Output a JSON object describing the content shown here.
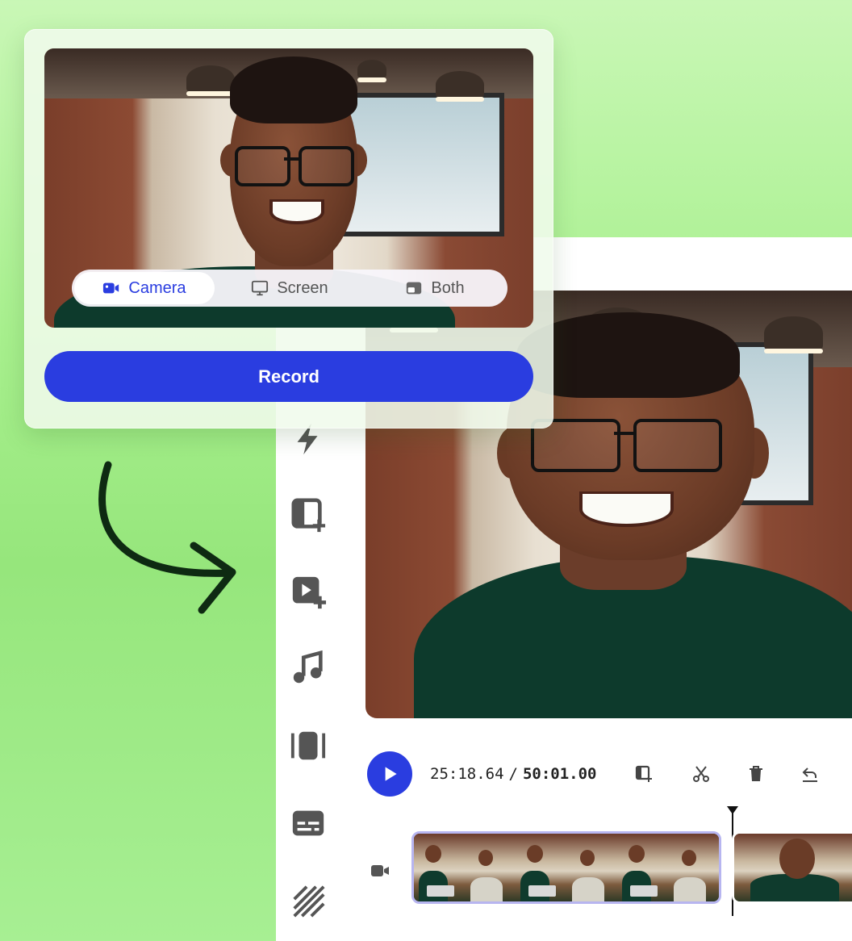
{
  "recorder": {
    "modes": [
      {
        "label": "Camera",
        "icon": "camera-icon",
        "active": true
      },
      {
        "label": "Screen",
        "icon": "monitor-icon",
        "active": false
      },
      {
        "label": "Both",
        "icon": "picture-in-picture-icon",
        "active": false
      }
    ],
    "record_label": "Record"
  },
  "editor": {
    "toolbar": [
      {
        "icon": "lightning-icon"
      },
      {
        "icon": "add-layout-icon"
      },
      {
        "icon": "add-video-icon"
      },
      {
        "icon": "music-note-icon"
      },
      {
        "icon": "resize-frame-icon"
      },
      {
        "icon": "subtitles-icon"
      },
      {
        "icon": "pattern-icon"
      }
    ],
    "playback": {
      "current_time": "25:18.64",
      "separator": "/",
      "total_time": "50:01.00"
    },
    "controls": [
      "add-clip-icon",
      "scissors-icon",
      "trash-icon",
      "undo-icon"
    ],
    "timeline": {
      "track_icon": "video-camera-icon"
    }
  },
  "colors": {
    "accent": "#2a3de0",
    "background_green": "#a8f08e",
    "arrow": "#0e2a12"
  }
}
